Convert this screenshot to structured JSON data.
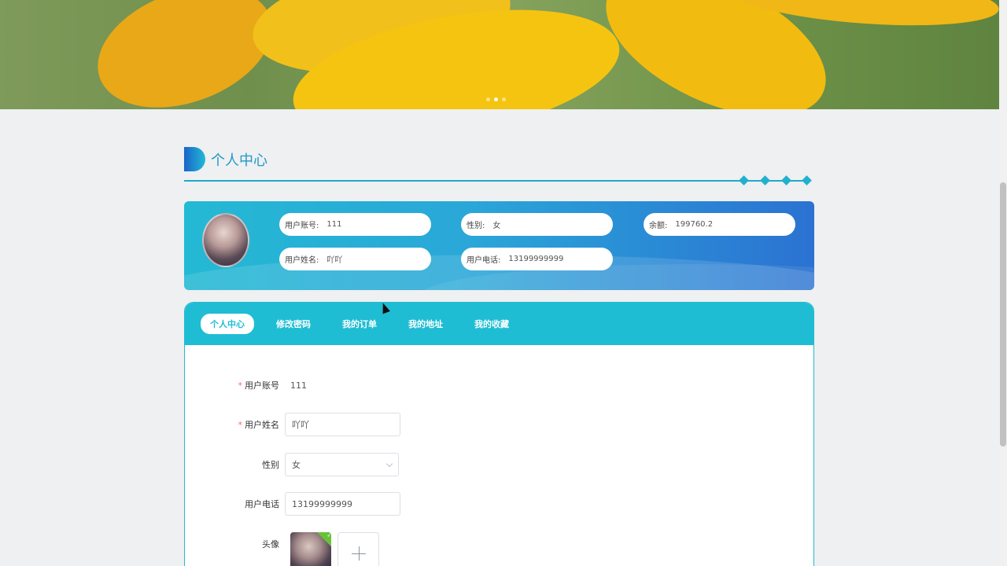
{
  "banner": {
    "slide_count": 3,
    "active_slide": 2
  },
  "section": {
    "title": "个人中心"
  },
  "profile": {
    "account_label": "用户账号:",
    "account_value": "111",
    "gender_label": "性别:",
    "gender_value": "女",
    "balance_label": "余额:",
    "balance_value": "199760.2",
    "name_label": "用户姓名:",
    "name_value": "吖吖",
    "phone_label": "用户电话:",
    "phone_value": "13199999999"
  },
  "tabs": [
    {
      "label": "个人中心",
      "active": true
    },
    {
      "label": "修改密码",
      "active": false
    },
    {
      "label": "我的订单",
      "active": false
    },
    {
      "label": "我的地址",
      "active": false
    },
    {
      "label": "我的收藏",
      "active": false
    }
  ],
  "form": {
    "account_label": "用户账号",
    "account_value": "111",
    "name_label": "用户姓名",
    "name_value": "吖吖",
    "gender_label": "性别",
    "gender_value": "女",
    "phone_label": "用户电话",
    "phone_value": "13199999999",
    "avatar_label": "头像",
    "required_mark": "*",
    "upload_check": "✓"
  },
  "colors": {
    "accent": "#1fbdd3",
    "accent_dark": "#2b72d2",
    "required": "#f56c6c",
    "success": "#67c23a"
  },
  "icons": {
    "dropdown": "chevron-down-icon",
    "upload": "plus-icon",
    "uploaded": "check-icon"
  }
}
